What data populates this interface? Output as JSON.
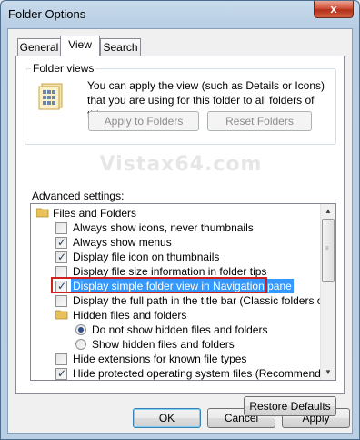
{
  "window": {
    "title": "Folder Options",
    "close_glyph": "x"
  },
  "tabs": [
    {
      "label": "General",
      "active": false
    },
    {
      "label": "View",
      "active": true
    },
    {
      "label": "Search",
      "active": false
    }
  ],
  "folder_views": {
    "group_label": "Folder views",
    "icon": "folder-views-icon",
    "description": "You can apply the view (such as Details or Icons) that you are using for this folder to all folders of this type.",
    "apply_button": "Apply to Folders",
    "reset_button": "Reset Folders"
  },
  "watermark": "Vistax64.com",
  "advanced": {
    "label": "Advanced settings:",
    "items": [
      {
        "type": "folder",
        "label": "Files and Folders"
      },
      {
        "type": "checkbox",
        "label": "Always show icons, never thumbnails",
        "checked": false
      },
      {
        "type": "checkbox",
        "label": "Always show menus",
        "checked": true
      },
      {
        "type": "checkbox",
        "label": "Display file icon on thumbnails",
        "checked": true
      },
      {
        "type": "checkbox",
        "label": "Display file size information in folder tips",
        "checked": false
      },
      {
        "type": "checkbox",
        "label": "Display simple folder view in Navigation pane",
        "checked": true,
        "selected": true
      },
      {
        "type": "checkbox",
        "label": "Display the full path in the title bar (Classic folders only)",
        "checked": false
      },
      {
        "type": "folder",
        "label": "Hidden files and folders"
      },
      {
        "type": "radio",
        "label": "Do not show hidden files and folders",
        "checked": true
      },
      {
        "type": "radio",
        "label": "Show hidden files and folders",
        "checked": false
      },
      {
        "type": "checkbox",
        "label": "Hide extensions for known file types",
        "checked": false
      },
      {
        "type": "checkbox",
        "label": "Hide protected operating system files (Recommended)",
        "checked": true
      }
    ],
    "restore_button": "Restore Defaults"
  },
  "footer": {
    "ok": "OK",
    "cancel": "Cancel",
    "apply": "Apply"
  },
  "colors": {
    "selection": "#3399ff",
    "highlight_box": "#d12020",
    "close_button": "#c94530"
  }
}
